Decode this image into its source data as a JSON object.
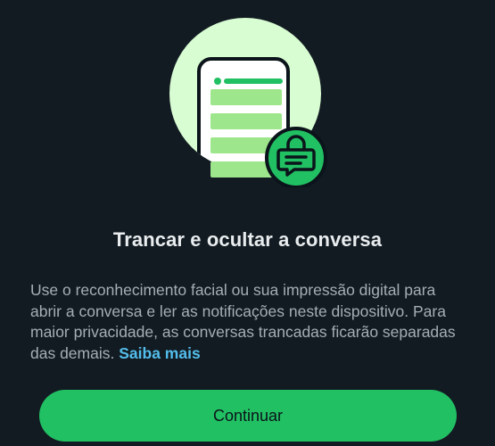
{
  "dialog": {
    "title": "Trancar e ocultar a conversa",
    "description": "Use o reconhecimento facial ou sua impressão digital para abrir a conversa e ler as notificações neste dispositivo. Para maior privacidade, as conversas trancadas ficarão separadas das demais.",
    "learn_more_label": "Saiba mais",
    "continue_label": "Continuar"
  },
  "illustration": {
    "icon": "phone-with-locked-chat-icon"
  },
  "colors": {
    "background": "#121b22",
    "accent": "#21c063",
    "link": "#53bdeb",
    "circle": "#d9fdd3"
  }
}
